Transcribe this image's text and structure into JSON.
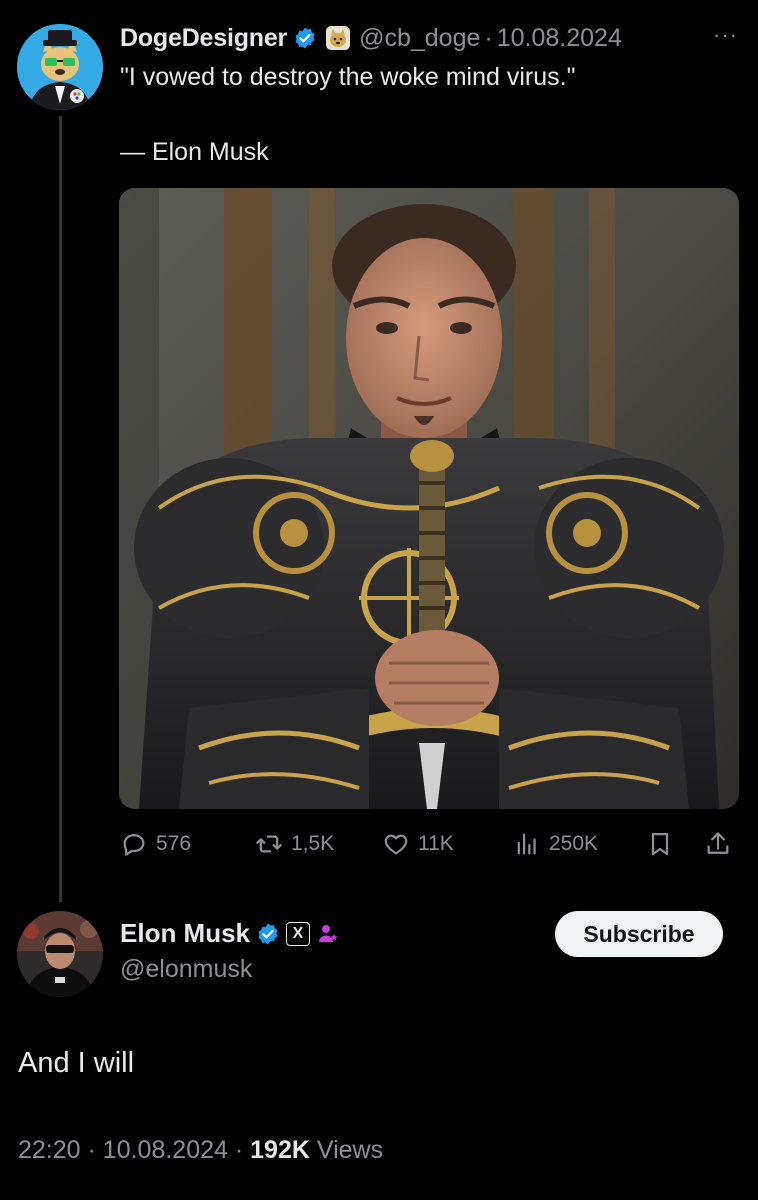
{
  "parent_tweet": {
    "author_name": "DogeDesigner",
    "handle": "@cb_doge",
    "separator": "·",
    "date": "10.08.2024",
    "more": "···",
    "text": "\"I vowed to destroy the woke mind virus.\"",
    "attribution": "— Elon Musk",
    "icons": [
      "verified-check-icon",
      "doge-badge-icon",
      "more-icon"
    ],
    "media_alt": "portrait of a man in ornate black and gold armor holding a sword",
    "actions": {
      "replies": "576",
      "reposts": "1,5K",
      "likes": "11K",
      "views": "250K"
    }
  },
  "reply": {
    "author_name": "Elon Musk",
    "handle": "@elonmusk",
    "subscribe_label": "Subscribe",
    "x_badge": "X",
    "text": "And I will",
    "time": "22:20",
    "separator": "·",
    "date": "10.08.2024",
    "views_count": "192K",
    "views_label": "Views"
  },
  "colors": {
    "background": "#000000",
    "text": "#e7e9ea",
    "muted": "#8b9095",
    "verified": "#1d9bf0",
    "subscribe_bg": "#eff3f4",
    "thread_line": "#333639",
    "affiliate_purple": "#c93ae0"
  }
}
